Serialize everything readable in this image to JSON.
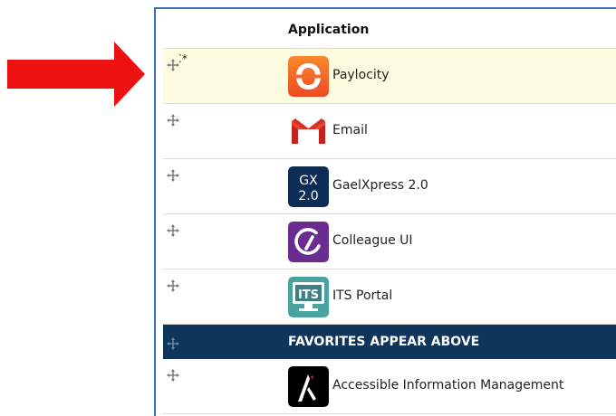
{
  "header": {
    "column_application": "Application"
  },
  "apps_above": [
    {
      "label": "Paylocity",
      "icon": "paylocity-icon",
      "selected": true
    },
    {
      "label": "Email",
      "icon": "gmail-icon"
    },
    {
      "label": "GaelXpress 2.0",
      "icon": "gaelxpress-icon",
      "icon_text_top": "GX",
      "icon_text_bottom": "2.0"
    },
    {
      "label": "Colleague UI",
      "icon": "colleague-icon"
    },
    {
      "label": "ITS Portal",
      "icon": "its-portal-icon",
      "icon_text": "ITS"
    }
  ],
  "banner": {
    "text": "FAVORITES APPEAR ABOVE"
  },
  "apps_below": [
    {
      "label": "Accessible Information Management",
      "icon": "aim-icon"
    }
  ],
  "colors": {
    "arrow": "#ee1111",
    "panel_border": "#3d6fb0",
    "selected_row": "#fdfbe0",
    "banner": "#0f355a"
  },
  "indicators": {
    "selected_marker": "⁚*"
  }
}
